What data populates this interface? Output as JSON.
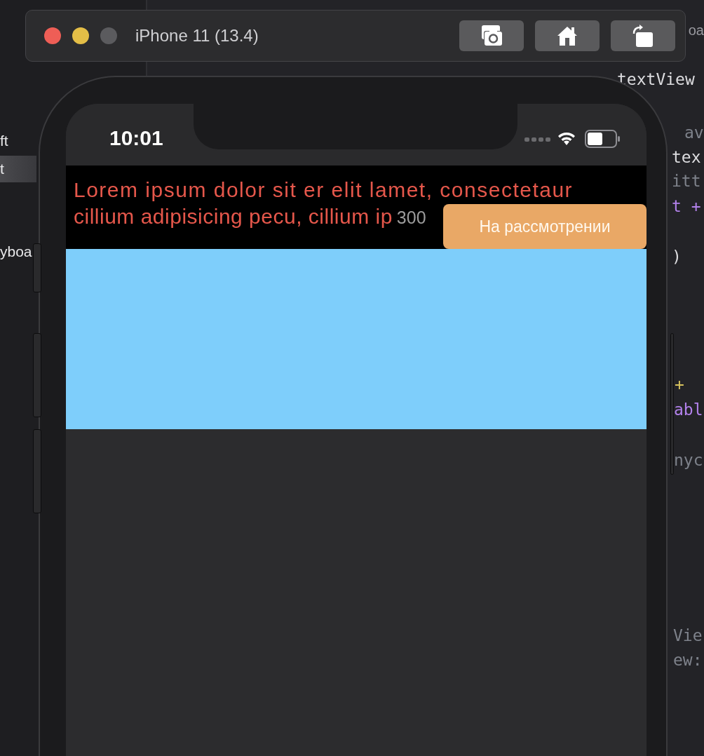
{
  "navigator": {
    "items": [
      {
        "label": "ft",
        "selected": false
      },
      {
        "label": "t",
        "selected": true
      },
      {
        "label": "yboa",
        "selected": false
      }
    ]
  },
  "editor": {
    "tab_label": "oa",
    "code_fragments": [
      {
        "text": "textView",
        "kind": "plain"
      },
      {
        "text": "av",
        "kind": "muted"
      },
      {
        "text": "tex",
        "kind": "plain"
      },
      {
        "text": "itt",
        "kind": "muted"
      },
      {
        "text": "t +",
        "kind": "keyword"
      },
      {
        "text": ")",
        "kind": "plain"
      },
      {
        "text": "+",
        "kind": "marker"
      },
      {
        "text": "abl",
        "kind": "keyword"
      },
      {
        "text": "nyc",
        "kind": "muted"
      },
      {
        "text": "Vie",
        "kind": "muted"
      },
      {
        "text": "ew:",
        "kind": "muted"
      }
    ]
  },
  "simulator": {
    "title": "iPhone 11 (13.4)",
    "zoom_enabled": false
  },
  "phone": {
    "status_bar": {
      "time": "10:01"
    },
    "header": {
      "lines": [
        "Lorem ipsum dolor sit er elit lamet, consectetaur",
        "cillium adipisicing pecu, cillium ip"
      ],
      "count": "300",
      "status_badge": "На рассмотрении"
    }
  }
}
